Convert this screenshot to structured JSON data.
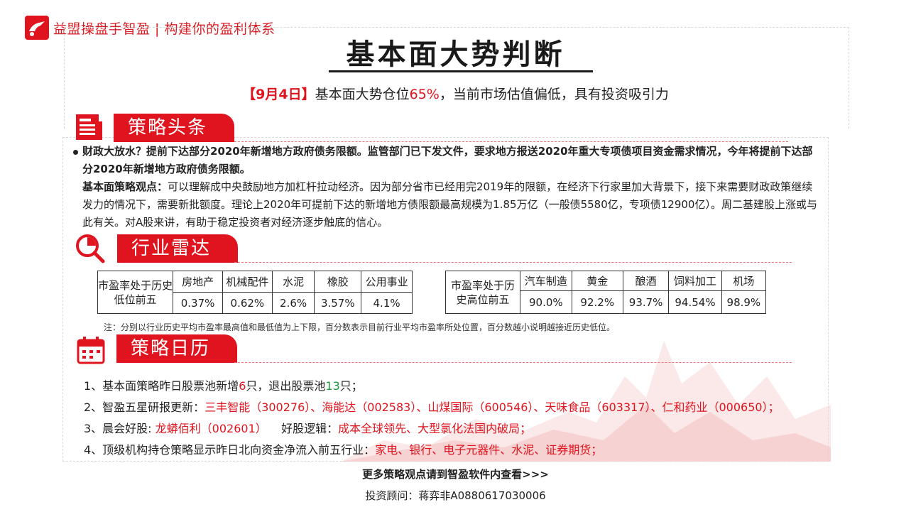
{
  "brand": {
    "logo_text": "益盟操盘手智盈 | 构建你的盈利体系",
    "accent_color": "#e0141e"
  },
  "title": "基本面大势判断",
  "subtitle": {
    "date": "【9月4日】",
    "text_a": "基本面大势仓位",
    "position": "65%",
    "text_b": "，当前市场估值偏低，具有投资吸引力"
  },
  "headlines": {
    "section_title": "策略头条",
    "icon": "newspaper-icon",
    "headline": "财政大放水？提前下达部分2020年新增地方政府债务限额。监管部门已下发文件，要求地方报送2020年重大专项债项目资金需求情况，今年将提前下达部分2020年新增地方政府债务限额。",
    "view_label": "基本面策略观点：",
    "view_text": "可以理解成中央鼓励地方加杠杆拉动经济。因为部分省市已经用完2019年的限额，在经济下行家里加大背景下，接下来需要财政政策继续发力的情况下，需要新批额度。理论上2020年可提前下达的新增地方债限额最高规模为1.85万亿（一般债5580亿，专项债12900亿）。周二基建股上涨或与此有关。对A股来讲，有助于稳定投资者对经济逐步触底的信心。"
  },
  "radar": {
    "section_title": "行业雷达",
    "icon": "pie-chart-magnifier-icon",
    "low": {
      "label": "市盈率处于历史低位前五",
      "industries": [
        "房地产",
        "机械配件",
        "水泥",
        "橡胶",
        "公用事业"
      ],
      "values": [
        "0.37%",
        "0.62%",
        "2.6%",
        "3.57%",
        "4.1%"
      ]
    },
    "high": {
      "label": "市盈率处于历史高位前五",
      "industries": [
        "汽车制造",
        "黄金",
        "酿酒",
        "饲料加工",
        "机场"
      ],
      "values": [
        "90.0%",
        "92.2%",
        "93.7%",
        "94.54%",
        "98.9%"
      ]
    },
    "note": "注：分别以行业历史平均市盈率最高值和最低值为上下限，百分数表示目前行业平均市盈率所处位置，百分数越小说明越接近历史低位。"
  },
  "calendar": {
    "section_title": "策略日历",
    "icon": "calendar-icon",
    "item1": {
      "a": "1、基本面策略昨日股票池新增",
      "n1": "6",
      "b": "只，退出股票池",
      "n2": "13",
      "c": "只；"
    },
    "item2": {
      "a": "2、智盈五星研报更新：",
      "stocks": "三丰智能（300276）、海能达（002583）、山煤国际（600546）、天味食品（603317）、仁和药业（000650）；"
    },
    "item3": {
      "a": "3、晨会好股: ",
      "stock": "龙蟒佰利（002601）",
      "b": "    好股逻辑：",
      "logic": "成本全球领先、大型氯化法国内破局；"
    },
    "item4": {
      "a": "4、顶级机构持仓策略显示昨日北向资金净流入前五行业：",
      "industries": "家电、银行、电子元器件、水泥、证券期货；"
    }
  },
  "footer": {
    "more": "更多策略观点请到智盈软件内查看>>>",
    "advisor": "投资顾问：蒋弈非A0880617030006"
  }
}
